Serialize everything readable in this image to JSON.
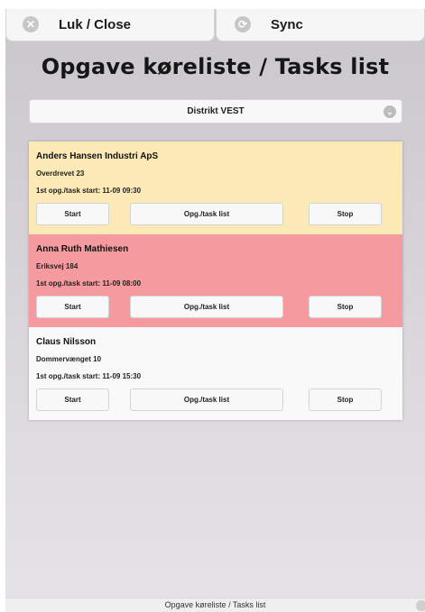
{
  "header": {
    "close_label": "Luk / Close",
    "sync_label": "Sync"
  },
  "page_title": "Opgave køreliste / Tasks list",
  "district": {
    "selected": "Distrikt VEST"
  },
  "tasks": [
    {
      "name": "Anders Hansen Industri ApS",
      "address": "Overdrevet 23",
      "start": "1st opg./task start: 11-09 09:30",
      "status_color": "#fbe9b6",
      "start_label": "Start",
      "list_label": "Opg./task list",
      "stop_label": "Stop"
    },
    {
      "name": "Anna Ruth Mathiesen",
      "address": "Eriksvej 184",
      "start": "1st opg./task start: 11-09 08:00",
      "status_color": "#f59ba0",
      "start_label": "Start",
      "list_label": "Opg./task list",
      "stop_label": "Stop"
    },
    {
      "name": "Claus Nilsson",
      "address": "Dommervænget 10",
      "start": "1st opg./task start: 11-09 15:30",
      "status_color": "#f9f9f9",
      "start_label": "Start",
      "list_label": "Opg./task list",
      "stop_label": "Stop"
    }
  ],
  "footer": {
    "title": "Opgave køreliste / Tasks list"
  }
}
